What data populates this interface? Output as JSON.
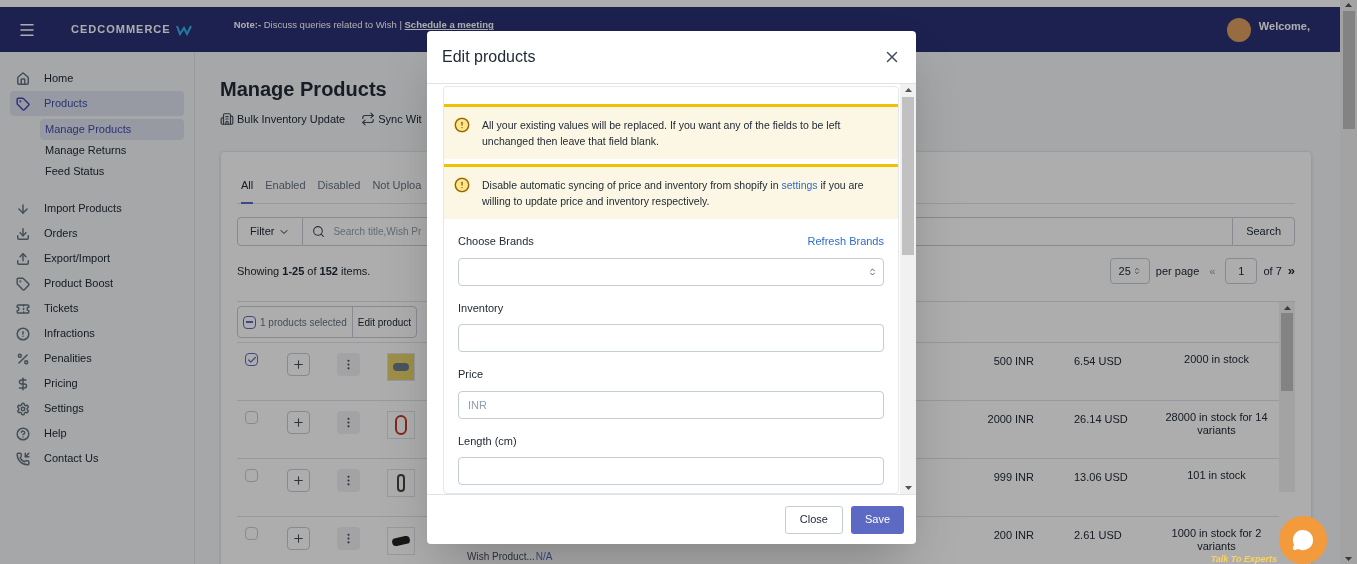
{
  "header": {
    "note_label": "Note:-",
    "note_text": " Discuss queries related to Wish | ",
    "note_link": "Schedule a meeting",
    "logo_text": "CEDCOMMERCE",
    "welcome": "Welcome,"
  },
  "sidebar": {
    "items": [
      {
        "label": "Home",
        "selected": false
      },
      {
        "label": "Products",
        "selected": true,
        "children": [
          {
            "label": "Manage Products",
            "selected": true
          },
          {
            "label": "Manage Returns",
            "selected": false
          },
          {
            "label": "Feed Status",
            "selected": false
          }
        ]
      },
      {
        "label": "Import Products",
        "selected": false
      },
      {
        "label": "Orders",
        "selected": false
      },
      {
        "label": "Export/Import",
        "selected": false
      },
      {
        "label": "Product Boost",
        "selected": false
      },
      {
        "label": "Tickets",
        "selected": false
      },
      {
        "label": "Infractions",
        "selected": false
      },
      {
        "label": "Penalities",
        "selected": false
      },
      {
        "label": "Pricing",
        "selected": false
      },
      {
        "label": "Settings",
        "selected": false
      },
      {
        "label": "Help",
        "selected": false
      },
      {
        "label": "Contact Us",
        "selected": false
      }
    ]
  },
  "page": {
    "title": "Manage Products",
    "actions": [
      "Bulk Inventory Update",
      "Sync Wit"
    ],
    "tabs": [
      {
        "label": "All",
        "selected": true
      },
      {
        "label": "Enabled",
        "selected": false
      },
      {
        "label": "Disabled",
        "selected": false
      },
      {
        "label": "Not Uploa",
        "selected": false
      }
    ],
    "filter_label": "Filter",
    "search_placeholder": "Search title,Wish Pr",
    "search_button": "Search",
    "showing": "Showing **1-25** of **152** items.",
    "per_page_value": "25",
    "per_page_label": "per page",
    "first_symbol": "«",
    "page_value": "1",
    "page_total": "of 7",
    "next_symbol": "»",
    "bulk": {
      "indeterminate": true,
      "selected_text": "1 products selected",
      "action": "Edit product"
    },
    "rows": [
      {
        "checked": true,
        "price_inr": "500 INR",
        "price_usd": "6.54 USD",
        "stock": "2000 in stock"
      },
      {
        "checked": false,
        "price_inr": "2000 INR",
        "price_usd": "26.14 USD",
        "stock": "28000 in stock for 14 variants"
      },
      {
        "checked": false,
        "price_inr": "999 INR",
        "price_usd": "13.06 USD",
        "stock": "101 in stock"
      },
      {
        "checked": false,
        "price_inr": "200 INR",
        "price_usd": "2.61 USD",
        "stock": "1000 in stock for 2 variants",
        "detail_label": "Wish Product...",
        "detail_value": "N/A"
      }
    ]
  },
  "modal": {
    "title": "Edit products",
    "alerts": [
      {
        "text": "All your existing values will be replaced. If you want any of the fields to be left unchanged then leave that field blank."
      },
      {
        "text": "Disable automatic syncing of price and inventory from shopify in ",
        "link": "settings",
        "text_after": " if you are willing to update price and inventory respectively."
      }
    ],
    "fields": [
      {
        "kind": "select",
        "label": "Choose Brands",
        "action": "Refresh Brands"
      },
      {
        "kind": "text",
        "label": "Inventory"
      },
      {
        "kind": "text",
        "label": "Price",
        "placeholder": "INR"
      },
      {
        "kind": "text",
        "label": "Length (cm)"
      }
    ],
    "buttons": [
      {
        "kind": "secondary",
        "label": "Close"
      },
      {
        "kind": "primary",
        "label": "Save"
      }
    ]
  },
  "chat": {
    "caption": "Talk To Experts"
  }
}
